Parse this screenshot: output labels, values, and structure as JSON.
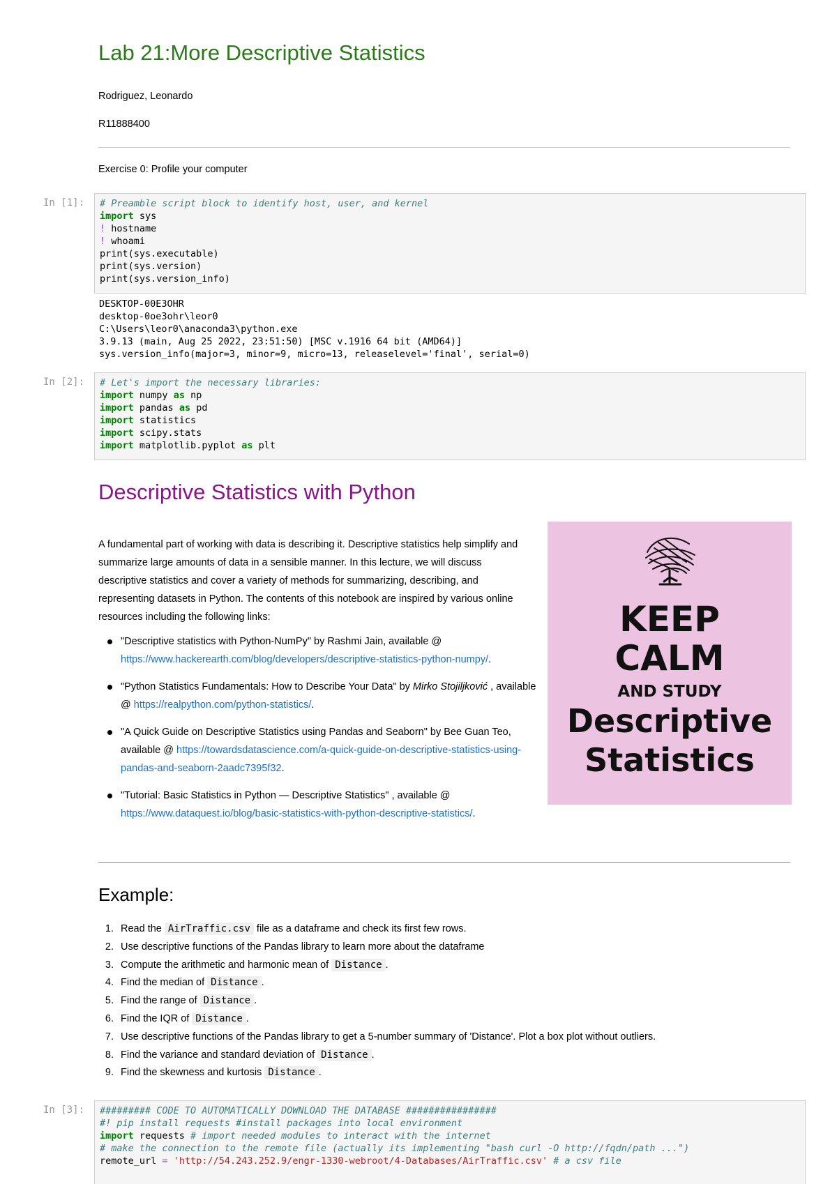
{
  "title": "Lab 21:More Descriptive Statistics",
  "author": "Rodriguez, Leonardo",
  "student_id": "R11888400",
  "exercise0": "Exercise 0: Profile your computer",
  "cell1": {
    "prompt": "In [1]:",
    "lines": [
      [
        [
          "cm",
          "# Preamble script block to identify host, user, and kernel"
        ]
      ],
      [
        [
          "kw",
          "import"
        ],
        [
          "fn",
          " sys"
        ]
      ],
      [
        [
          "op",
          "!"
        ],
        [
          "fn",
          " hostname"
        ]
      ],
      [
        [
          "op",
          "!"
        ],
        [
          "fn",
          " whoami"
        ]
      ],
      [
        [
          "fn",
          "print(sys.executable)"
        ]
      ],
      [
        [
          "fn",
          "print(sys.version)"
        ]
      ],
      [
        [
          "fn",
          "print(sys.version_info)"
        ]
      ]
    ],
    "output": "DESKTOP-00E3OHR\ndesktop-0oe3ohr\\leor0\nC:\\Users\\leor0\\anaconda3\\python.exe\n3.9.13 (main, Aug 25 2022, 23:51:50) [MSC v.1916 64 bit (AMD64)]\nsys.version_info(major=3, minor=9, micro=13, releaselevel='final', serial=0)"
  },
  "cell2": {
    "prompt": "In [2]:",
    "lines": [
      [
        [
          "cm",
          "# Let's import the necessary libraries:"
        ]
      ],
      [
        [
          "kw",
          "import"
        ],
        [
          "fn",
          " numpy "
        ],
        [
          "kw",
          "as"
        ],
        [
          "fn",
          " np"
        ]
      ],
      [
        [
          "kw",
          "import"
        ],
        [
          "fn",
          " pandas "
        ],
        [
          "kw",
          "as"
        ],
        [
          "fn",
          " pd"
        ]
      ],
      [
        [
          "kw",
          "import"
        ],
        [
          "fn",
          " statistics"
        ]
      ],
      [
        [
          "kw",
          "import"
        ],
        [
          "fn",
          " scipy.stats"
        ]
      ],
      [
        [
          "kw",
          "import"
        ],
        [
          "fn",
          " matplotlib.pyplot "
        ],
        [
          "kw",
          "as"
        ],
        [
          "fn",
          " plt"
        ]
      ]
    ]
  },
  "section_title": "Descriptive Statistics with Python",
  "intro": "A fundamental part of working with data is describing it. Descriptive statistics help simplify and summarize large amounts of data in a sensible manner. In this lecture, we will discuss descriptive statistics and cover a variety of methods for summarizing, describing, and representing datasets in Python. The contents of this notebook are inspired by various online resources including the following links:",
  "refs": [
    {
      "pre": "\"Descriptive statistics with Python-NumPy\" by Rashmi Jain, available @ ",
      "em": "",
      "mid": "",
      "link": "https://www.hackerearth.com/blog/developers/descriptive-statistics-python-numpy/",
      "post": "."
    },
    {
      "pre": "\"Python Statistics Fundamentals: How to Describe Your Data\" by ",
      "em": "Mirko Stojiljković",
      "mid": " , available @ ",
      "link": "https://realpython.com/python-statistics/",
      "post": "."
    },
    {
      "pre": "\"A Quick Guide on Descriptive Statistics using Pandas and Seaborn\" by Bee Guan Teo, available @ ",
      "em": "",
      "mid": "",
      "link": "https://towardsdatascience.com/a-quick-guide-on-descriptive-statistics-using-pandas-and-seaborn-2aadc7395f32",
      "post": "."
    },
    {
      "pre": "\"Tutorial: Basic Statistics in Python — Descriptive Statistics\" , available @ ",
      "em": "",
      "mid": "",
      "link": "https://www.dataquest.io/blog/basic-statistics-with-python-descriptive-statistics/",
      "post": "."
    }
  ],
  "poster": {
    "line1": "KEEP",
    "line2": "CALM",
    "line3": "AND STUDY",
    "line4": "Descriptive",
    "line5": "Statistics",
    "bg": "#edc3e2"
  },
  "example_title": "Example:",
  "steps": [
    {
      "n": "1.",
      "parts": [
        [
          "t",
          "Read the "
        ],
        [
          "c",
          "AirTraffic.csv"
        ],
        [
          "t",
          " file as a dataframe and check its first few rows."
        ]
      ]
    },
    {
      "n": "2.",
      "parts": [
        [
          "t",
          "Use descriptive functions of the Pandas library to learn more about the dataframe"
        ]
      ]
    },
    {
      "n": "3.",
      "parts": [
        [
          "t",
          "Compute the arithmetic and harmonic mean of "
        ],
        [
          "c",
          "Distance"
        ],
        [
          "t",
          "."
        ]
      ]
    },
    {
      "n": "4.",
      "parts": [
        [
          "t",
          "Find the median of "
        ],
        [
          "c",
          "Distance"
        ],
        [
          "t",
          "."
        ]
      ]
    },
    {
      "n": "5.",
      "parts": [
        [
          "t",
          "Find the range of "
        ],
        [
          "c",
          "Distance"
        ],
        [
          "t",
          "."
        ]
      ]
    },
    {
      "n": "6.",
      "parts": [
        [
          "t",
          "Find the IQR of "
        ],
        [
          "c",
          "Distance"
        ],
        [
          "t",
          "."
        ]
      ]
    },
    {
      "n": "7.",
      "parts": [
        [
          "t",
          "Use descriptive functions of the Pandas library to get a 5-number summary of 'Distance'. Plot a box plot without outliers."
        ]
      ]
    },
    {
      "n": "8.",
      "parts": [
        [
          "t",
          "Find the variance and standard deviation of "
        ],
        [
          "c",
          "Distance"
        ],
        [
          "t",
          "."
        ]
      ]
    },
    {
      "n": "9.",
      "parts": [
        [
          "t",
          "Find the skewness and kurtosis "
        ],
        [
          "c",
          "Distance"
        ],
        [
          "t",
          "."
        ]
      ]
    }
  ],
  "cell3": {
    "prompt": "In [3]:",
    "lines": [
      [
        [
          "cm",
          "######### CODE TO AUTOMATICALLY DOWNLOAD THE DATABASE ################"
        ]
      ],
      [
        [
          "cm",
          "#! pip install requests #install packages into local environment"
        ]
      ],
      [
        [
          "kw",
          "import"
        ],
        [
          "fn",
          " requests "
        ],
        [
          "cm",
          "# import needed modules to interact with the internet"
        ]
      ],
      [
        [
          "cm",
          "# make the connection to the remote file (actually its implementing \"bash curl -O http://fqdn/path ...\")"
        ]
      ],
      [
        [
          "fn",
          "remote_url "
        ],
        [
          "op",
          "="
        ],
        [
          "fn",
          " "
        ],
        [
          "str",
          "'http://54.243.252.9/engr-1330-webroot/4-Databases/AirTraffic.csv'"
        ],
        [
          "fn",
          " "
        ],
        [
          "cm",
          "# a csv file"
        ]
      ]
    ]
  },
  "colors": {
    "title": "#2b7a19",
    "section": "#8a148a",
    "link": "#1a6fcc"
  }
}
